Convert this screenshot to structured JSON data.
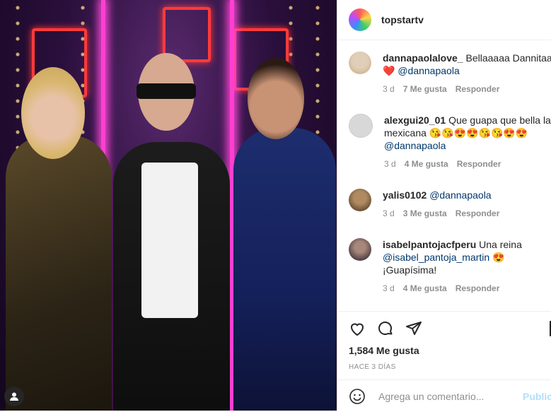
{
  "header": {
    "username": "topstartv"
  },
  "comments": [
    {
      "username": "dannapaolalove_",
      "text": "Bellaaaaa Dannitaa❤️",
      "mention": "@dannapaola",
      "age": "3 d",
      "likes": "7 Me gusta",
      "reply": "Responder"
    },
    {
      "username": "alexgui20_01",
      "text": "Que guapa que bella la mexicana 😘😘😍😍😘😘😍😍",
      "mention": "@dannapaola",
      "age": "3 d",
      "likes": "4 Me gusta",
      "reply": "Responder"
    },
    {
      "username": "yalis0102",
      "text": "",
      "mention": "@dannapaola",
      "age": "3 d",
      "likes": "3 Me gusta",
      "reply": "Responder"
    },
    {
      "username": "isabelpantojacfperu",
      "text": "Una reina",
      "mention": "@isabel_pantoja_martin",
      "text_after": "😍 ¡Guapísima!",
      "age": "3 d",
      "likes": "4 Me gusta",
      "reply": "Responder"
    }
  ],
  "post": {
    "likes": "1,584 Me gusta",
    "time_ago": "HACE 3 DÍAS"
  },
  "add_comment": {
    "placeholder": "Agrega un comentario...",
    "publish": "Publicar"
  },
  "icons": [
    "heart-icon",
    "comment-icon",
    "share-icon",
    "bookmark-icon",
    "emoji-icon",
    "user-icon"
  ]
}
